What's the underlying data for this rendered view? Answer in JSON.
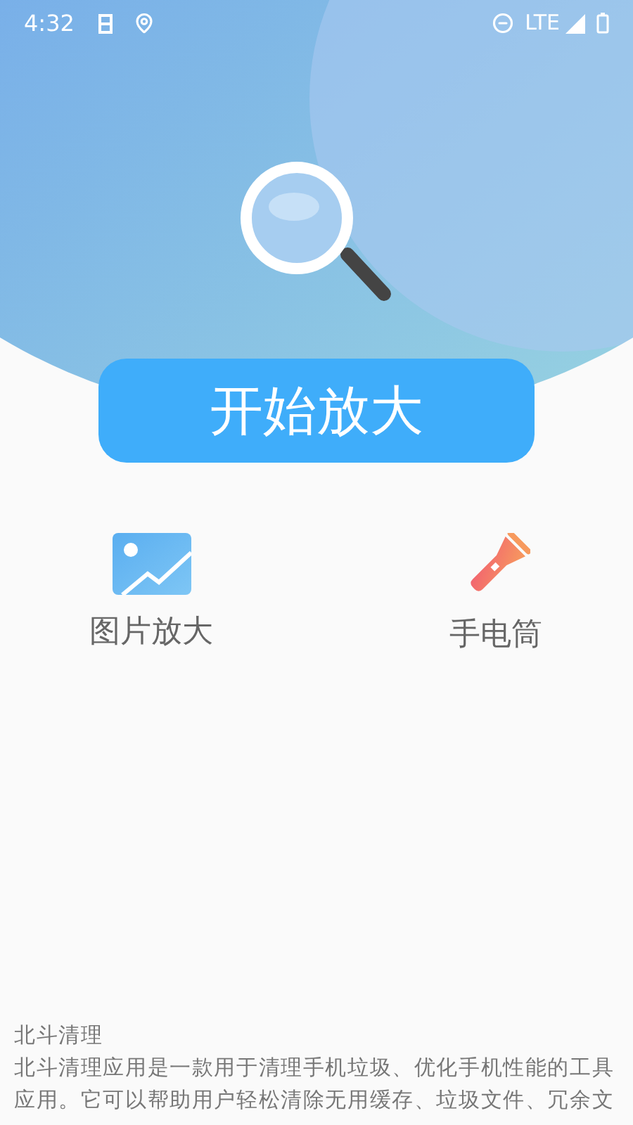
{
  "status_bar": {
    "time": "4:32",
    "network": "LTE"
  },
  "main_button": {
    "label": "开始放大"
  },
  "features": [
    {
      "kind": "image",
      "label": "图片放大"
    },
    {
      "kind": "flashlight",
      "label": "手电筒"
    }
  ],
  "about": {
    "title": "北斗清理",
    "text": "北斗清理应用是一款用于清理手机垃圾、优化手机性能的工具应用。它可以帮助用户轻松清除无用缓存、垃圾文件、冗余文"
  }
}
